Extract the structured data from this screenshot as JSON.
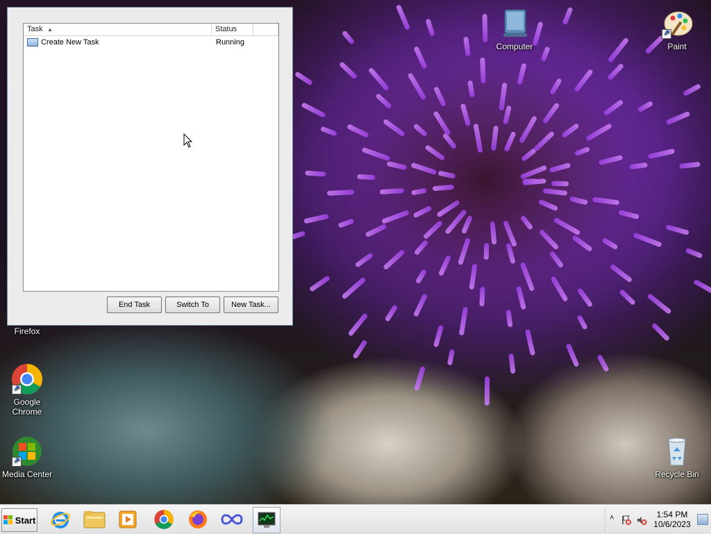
{
  "desktop": {
    "icons": [
      {
        "label": "Computer"
      },
      {
        "label": "Paint"
      },
      {
        "label": "Firefox"
      },
      {
        "label": "Google Chrome"
      },
      {
        "label": "Media Center"
      },
      {
        "label": "Recycle Bin"
      }
    ]
  },
  "task_manager": {
    "columns": [
      "Task",
      "Status"
    ],
    "rows": [
      {
        "task": "Create New Task",
        "status": "Running"
      }
    ],
    "buttons": {
      "end_task": "End Task",
      "switch_to": "Switch To",
      "new_task": "New Task..."
    }
  },
  "taskbar": {
    "start_label": "Start",
    "pinned": [
      "internet-explorer-icon",
      "windows-explorer-icon",
      "media-player-icon",
      "chrome-icon",
      "firefox-icon",
      "infinity-app-icon",
      "task-manager-icon"
    ],
    "clock": {
      "time": "1:54 PM",
      "date": "10/6/2023"
    }
  },
  "colors": {
    "taskbar": "#e9e9e9",
    "window_face": "#ececec",
    "accent_blue": "#1f5fc8"
  }
}
